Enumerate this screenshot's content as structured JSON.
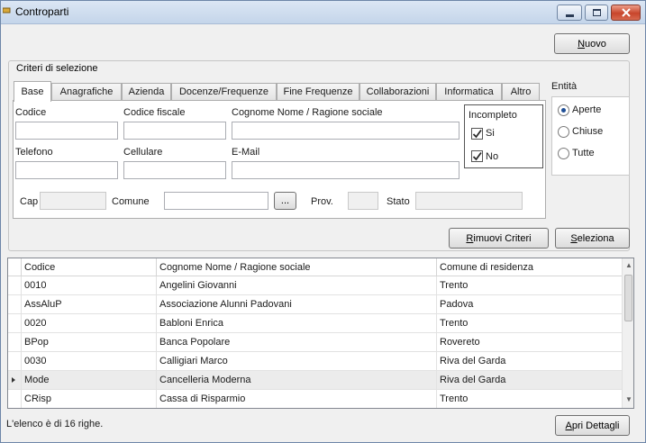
{
  "window": {
    "title": "Controparti"
  },
  "toolbar": {
    "nuovo_prefix": "",
    "nuovo_key": "N",
    "nuovo_rest": "uovo"
  },
  "criteria": {
    "group_label": "Criteri di selezione",
    "tabs": [
      "Base",
      "Anagrafiche",
      "Azienda",
      "Docenze/Frequenze",
      "Fine Frequenze",
      "Collaborazioni",
      "Informatica",
      "Altro"
    ],
    "active_tab": "Base",
    "fields": {
      "codice": {
        "label": "Codice",
        "value": ""
      },
      "codice_fiscale": {
        "label": "Codice fiscale",
        "value": ""
      },
      "cognome_nome": {
        "label": "Cognome Nome / Ragione sociale",
        "value": ""
      },
      "telefono": {
        "label": "Telefono",
        "value": ""
      },
      "cellulare": {
        "label": "Cellulare",
        "value": ""
      },
      "email": {
        "label": "E-Mail",
        "value": ""
      },
      "cap": {
        "label": "Cap",
        "value": ""
      },
      "comune": {
        "label": "Comune",
        "value": ""
      },
      "prov": {
        "label": "Prov.",
        "value": ""
      },
      "stato": {
        "label": "Stato",
        "value": ""
      }
    },
    "browse_button": "...",
    "incompleto": {
      "label": "Incompleto",
      "options": [
        {
          "label": "Si",
          "checked": true
        },
        {
          "label": "No",
          "checked": true
        }
      ]
    }
  },
  "entita": {
    "label": "Entità",
    "options": [
      {
        "label": "Aperte",
        "selected": true
      },
      {
        "label": "Chiuse",
        "selected": false
      },
      {
        "label": "Tutte",
        "selected": false
      }
    ]
  },
  "actions": {
    "rimuovi_key": "R",
    "rimuovi_rest": "imuovi Criteri",
    "seleziona_prefix": "",
    "seleziona_key": "S",
    "seleziona_rest": "eleziona"
  },
  "grid": {
    "columns": [
      "Codice",
      "Cognome Nome / Ragione sociale",
      "Comune di residenza"
    ],
    "rows": [
      [
        "0010",
        "Angelini Giovanni",
        "Trento"
      ],
      [
        "AssAluP",
        "Associazione Alunni Padovani",
        "Padova"
      ],
      [
        "0020",
        "Babloni Enrica",
        "Trento"
      ],
      [
        "BPop",
        "Banca Popolare",
        "Rovereto"
      ],
      [
        "0030",
        "Calligiari Marco",
        "Riva del Garda"
      ],
      [
        "Mode",
        "Cancelleria Moderna",
        "Riva del Garda"
      ],
      [
        "CRisp",
        "Cassa di Risparmio",
        "Trento"
      ]
    ],
    "current_row": 5
  },
  "status": {
    "text": "L'elenco è di 16 righe."
  },
  "footer": {
    "dettagli_prefix": "",
    "dettagli_key": "A",
    "dettagli_rest": "pri Dettagli"
  },
  "colors": {
    "accent": "#1f4e96",
    "title_bg": "#c4d5ea",
    "close": "#c8452b"
  }
}
